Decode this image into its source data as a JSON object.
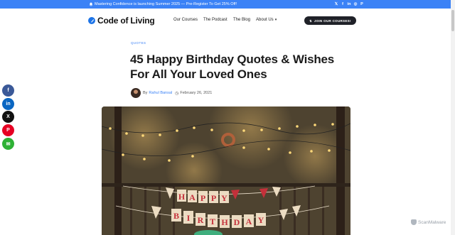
{
  "announcement": {
    "text": "Mastering Confidence is launching Summer 2025 — Pre-Register To Get 25% Off!",
    "bell_icon": "bell-icon",
    "social": [
      {
        "name": "twitter-icon",
        "glyph": "𝕏"
      },
      {
        "name": "facebook-icon",
        "glyph": "f"
      },
      {
        "name": "linkedin-icon",
        "glyph": "in"
      },
      {
        "name": "instagram-icon",
        "glyph": "◎"
      },
      {
        "name": "pinterest-icon",
        "glyph": "P"
      }
    ]
  },
  "header": {
    "logo_text": "Code of Living",
    "nav": [
      {
        "label": "Our Courses"
      },
      {
        "label": "The Podcast"
      },
      {
        "label": "The Blog"
      },
      {
        "label": "About Us",
        "chevron": "▾"
      }
    ],
    "cta_label": "JOIN OUR COURSES!",
    "cta_icon": "⇅"
  },
  "article": {
    "category": "QUOTES",
    "title": "45 Happy Birthday Quotes & Wishes For All Your Loved Ones",
    "by_label": "By",
    "author": "Rahul Bansal",
    "date": "February 26, 2021",
    "clock_icon": "◷"
  },
  "hero": {
    "banner_top": [
      "H",
      "A",
      "P",
      "P",
      "Y"
    ],
    "banner_bottom": [
      "B",
      "I",
      "R",
      "T",
      "H",
      "D",
      "A",
      "Y"
    ]
  },
  "share": [
    {
      "name": "share-facebook-button",
      "glyph": "f",
      "color": "#3b5998"
    },
    {
      "name": "share-linkedin-button",
      "glyph": "in",
      "color": "#0a66c2"
    },
    {
      "name": "share-x-button",
      "glyph": "X",
      "color": "#111111"
    },
    {
      "name": "share-pinterest-button",
      "glyph": "P",
      "color": "#e60023"
    },
    {
      "name": "share-email-button",
      "glyph": "✉",
      "color": "#2eb135"
    }
  ],
  "badge": {
    "text": "ScanMalware"
  },
  "colors": {
    "accent": "#3b82f6",
    "cta_bg": "#1f2128"
  }
}
